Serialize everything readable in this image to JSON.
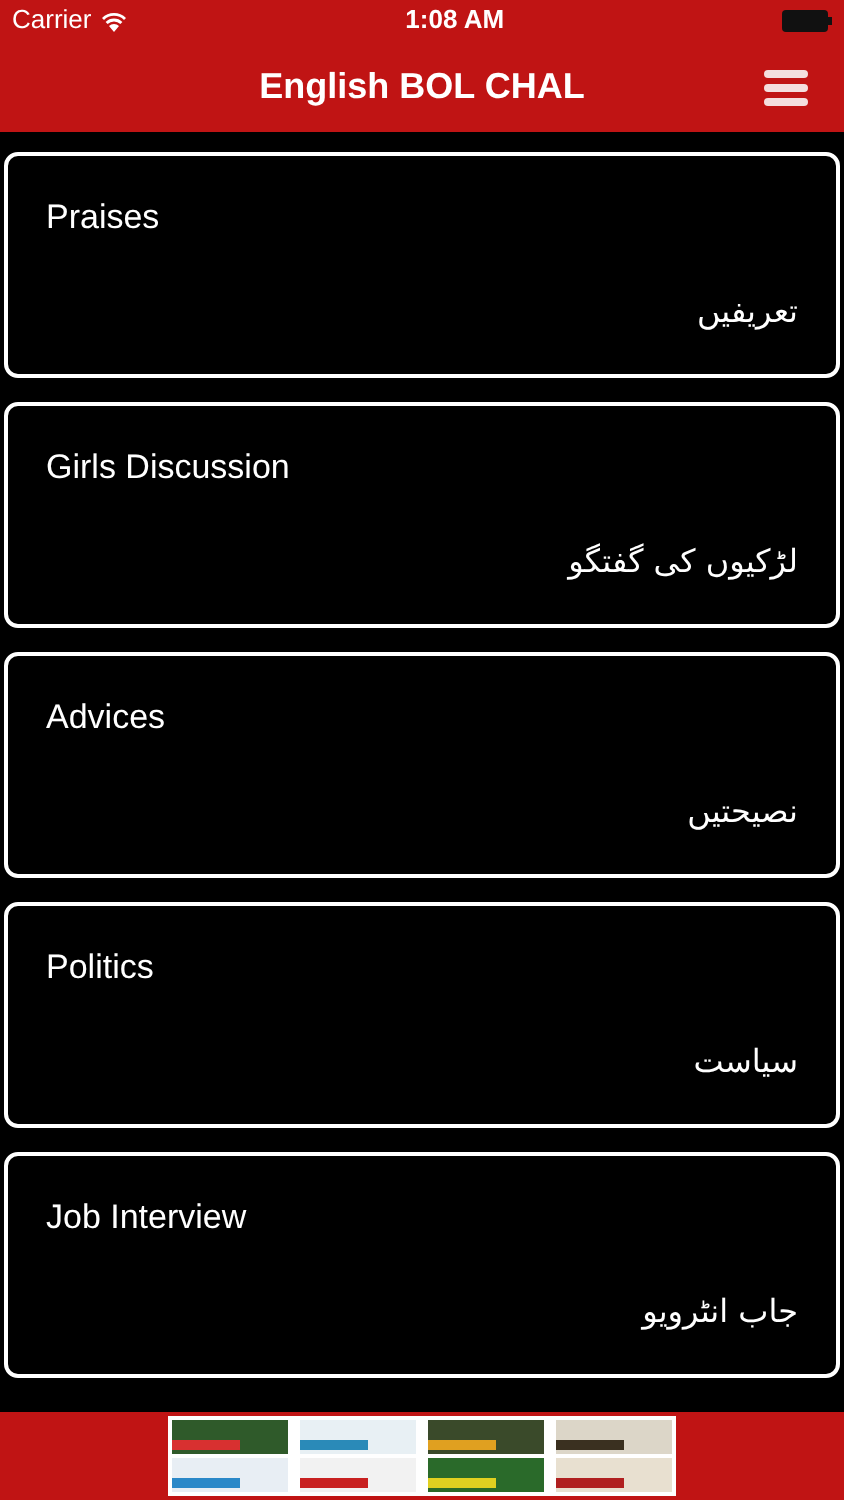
{
  "status_bar": {
    "carrier": "Carrier",
    "time": "1:08 AM"
  },
  "navbar": {
    "title": "English BOL CHAL"
  },
  "topics": [
    {
      "english": "Praises",
      "urdu": "تعریفیں"
    },
    {
      "english": "Girls Discussion",
      "urdu": "لڑکیوں کی گفتگو"
    },
    {
      "english": "Advices",
      "urdu": "نصیحتیں"
    },
    {
      "english": "Politics",
      "urdu": "سیاست"
    },
    {
      "english": "Job Interview",
      "urdu": "جاب انٹرویو"
    }
  ]
}
